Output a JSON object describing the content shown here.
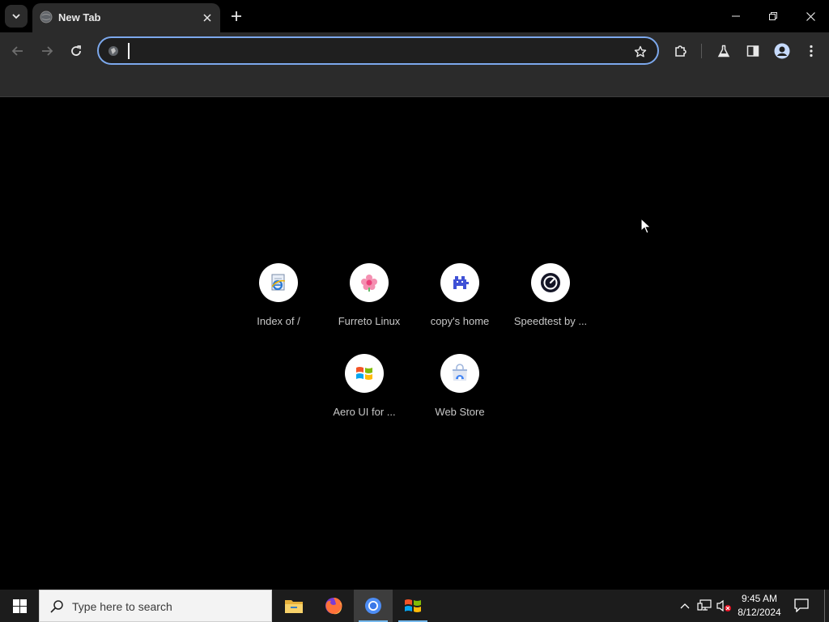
{
  "browser": {
    "tab": {
      "title": "New Tab"
    },
    "omnibox": {
      "value": "",
      "placeholder": ""
    }
  },
  "new_tab_page": {
    "shortcuts": [
      {
        "label": "Index of /",
        "icon": "ie-page-icon"
      },
      {
        "label": "Furreto Linux",
        "icon": "pink-flower-icon"
      },
      {
        "label": "copy's home",
        "icon": "blue-pixel-creature-icon"
      },
      {
        "label": "Speedtest by ...",
        "icon": "speedtest-gauge-icon"
      },
      {
        "label": "Aero UI for ...",
        "icon": "windows-flag-icon"
      },
      {
        "label": "Web Store",
        "icon": "web-store-icon"
      }
    ]
  },
  "taskbar": {
    "search_placeholder": "Type here to search",
    "clock": {
      "time": "9:45 AM",
      "date": "8/12/2024"
    }
  },
  "colors": {
    "focus_ring": "#7ca8ec",
    "toolbar_bg": "#2b2b2b",
    "content_bg": "#000000",
    "taskbar_bg": "#1c1c1c"
  }
}
